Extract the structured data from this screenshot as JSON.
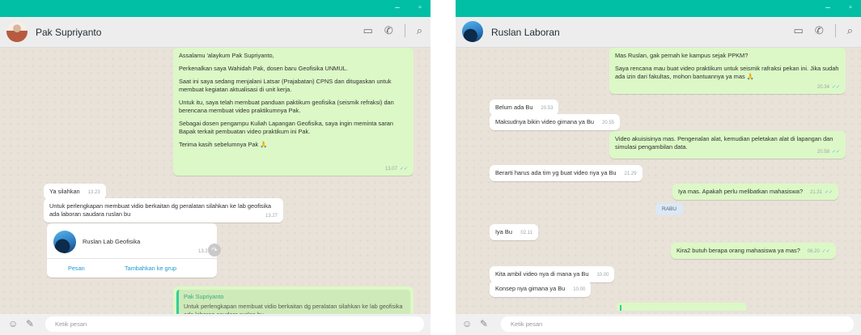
{
  "left": {
    "window_controls": {
      "minimize": "–",
      "maximize": "▫"
    },
    "contact_name": "Pak Supriyanto",
    "header_icons": [
      "video-icon",
      "phone-icon",
      "search-icon"
    ],
    "messages": [
      {
        "dir": "out",
        "paragraphs": [
          "Assalamu 'alaykum Pak Supriyanto,",
          "Perkenalkan saya Wahidah Pak, dosen baru Geofisika UNMUL.",
          "Saat ini saya sedang menjalani Latsar (Prajabatan) CPNS dan ditugaskan untuk membuat kegiatan aktualisasi di unit kerja.",
          "Untuk itu, saya telah membuat panduan paktikum geofisika (seismik refraksi) dan berencana membuat video praktikumnya Pak.",
          "Sebagai dosen pengampu Kuliah Lapangan Geofisika, saya ingin meminta saran Bapak terkait pembuatan video praktikum ini Pak.",
          "Terima kasih sebelumnya Pak 🙏"
        ],
        "time": "13.07",
        "ticks": "✓✓"
      },
      {
        "dir": "in",
        "paragraphs": [
          "Ya silahkan"
        ],
        "time": "13.23"
      },
      {
        "dir": "in",
        "paragraphs": [
          "Untuk perlengkapan membuat vidio berkaitan dg peralatan silahkan ke lab geofisika ada laboran saudara ruslan bu"
        ],
        "time": "13.27"
      }
    ],
    "contact_card": {
      "name": "Ruslan Lab Geofisika",
      "time": "13.27",
      "message_button": "Pesan",
      "add_group_button": "Tambahkan ke grup"
    },
    "forward_icon": "↷",
    "quoted": {
      "author": "Pak Supriyanto",
      "text": "Untuk perlengkapan membuat vidio berkaitan dg peralatan silahkan ke lab geofisika ada laboran saudara ruslan bu"
    },
    "composer": {
      "placeholder": "Ketik pesan",
      "emoji_glyph": "☺",
      "attach_glyph": "✎"
    }
  },
  "right": {
    "window_controls": {
      "minimize": "–",
      "maximize": "▫"
    },
    "contact_name": "Ruslan Laboran",
    "header_icons": [
      "video-icon",
      "phone-icon",
      "search-icon"
    ],
    "messages": [
      {
        "dir": "out",
        "paragraphs": [
          "Mas Ruslan, gak pernah ke kampus sejak PPKM?",
          "Saya rencana mau buat video praktikum untuk seismik rafraksi pekan ini. Jika sudah ada izin dari fakultas, mohon bantuannya ya mas 🙏"
        ],
        "time": "20.34",
        "ticks": "✓✓"
      },
      {
        "dir": "in",
        "paragraphs": [
          "Belum ada Bu"
        ],
        "time": "20.53"
      },
      {
        "dir": "in",
        "paragraphs": [
          "Maksudnya bikin video gimana ya Bu"
        ],
        "time": "20.55"
      },
      {
        "dir": "out",
        "paragraphs": [
          "Video akuisisinya mas. Pengenalan alat, kemudian peletakan alat di lapangan dan simulasi pengambilan data."
        ],
        "time": "20.58",
        "ticks": "✓✓"
      },
      {
        "dir": "in",
        "paragraphs": [
          "Berarti harus ada tim yg buat video nya ya Bu"
        ],
        "time": "21.29"
      },
      {
        "dir": "out",
        "paragraphs": [
          "Iya mas. Apakah perlu melibatkan mahasiswa?"
        ],
        "time": "21.31",
        "ticks": "✓✓"
      },
      {
        "dir": "in",
        "paragraphs": [
          "Iya Bu"
        ],
        "time": "02.11"
      },
      {
        "dir": "out",
        "paragraphs": [
          "Kira2 butuh berapa orang mahasiswa ya mas?"
        ],
        "time": "06.20",
        "ticks": "✓✓"
      },
      {
        "dir": "in",
        "paragraphs": [
          "Kita ambil video nya di mana ya Bu"
        ],
        "time": "10.00"
      },
      {
        "dir": "in",
        "paragraphs": [
          "Konsep nya gimana ya Bu"
        ],
        "time": "10.00"
      }
    ],
    "day_separator": "RABU",
    "composer": {
      "placeholder": "Ketik pesan",
      "emoji_glyph": "☺",
      "attach_glyph": "✎"
    }
  },
  "icon_glyphs": {
    "video": "▭",
    "phone": "✆",
    "search": "⌕"
  },
  "colors": {
    "title_bar": "#00bfa5",
    "header_bg": "#ededed",
    "chat_bg": "#e9e2d9",
    "incoming_bubble": "#ffffff",
    "outgoing_bubble": "#dcf8c6",
    "read_ticks": "#53bdeb",
    "link_blue": "#1b9ad1"
  }
}
